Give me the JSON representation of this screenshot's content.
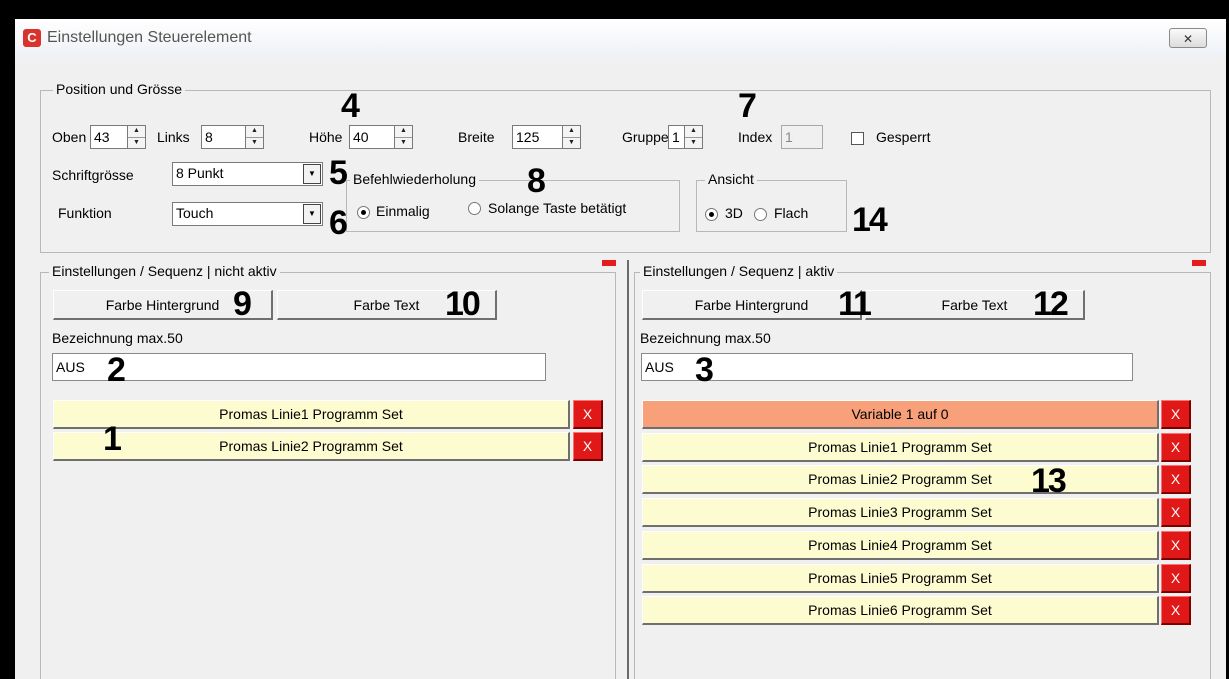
{
  "window": {
    "title": "Einstellungen Steuerelement",
    "close_label": "✕"
  },
  "position": {
    "legend": "Position und Grösse",
    "oben_label": "Oben",
    "oben_value": "43",
    "links_label": "Links",
    "links_value": "8",
    "hoehe_label": "Höhe",
    "hoehe_value": "40",
    "breite_label": "Breite",
    "breite_value": "125",
    "gruppe_label": "Gruppe",
    "gruppe_value": "1",
    "index_label": "Index",
    "index_value": "1",
    "gesperrt_label": "Gesperrt",
    "schriftgroesse_label": "Schriftgrösse",
    "schriftgroesse_value": "8 Punkt",
    "funktion_label": "Funktion",
    "funktion_value": "Touch"
  },
  "befehl": {
    "legend": "Befehlwiederholung",
    "option1": "Einmalig",
    "option2": "Solange Taste betätigt"
  },
  "ansicht": {
    "legend": "Ansicht",
    "option1": "3D",
    "option2": "Flach"
  },
  "left_panel": {
    "legend": "Einstellungen / Sequenz | nicht aktiv",
    "btn_bg": "Farbe Hintergrund",
    "btn_text": "Farbe Text",
    "bez_label": "Bezeichnung max.50",
    "bez_value": "AUS",
    "items": [
      "Promas Linie1 Programm Set",
      "Promas Linie2 Programm Set"
    ]
  },
  "right_panel": {
    "legend": "Einstellungen / Sequenz | aktiv",
    "btn_bg": "Farbe Hintergrund",
    "btn_text": "Farbe Text",
    "bez_label": "Bezeichnung max.50",
    "bez_value": "AUS",
    "items": [
      "Variable 1 auf 0",
      "Promas Linie1 Programm Set",
      "Promas Linie2 Programm Set",
      "Promas Linie3 Programm Set",
      "Promas Linie4 Programm Set",
      "Promas Linie5 Programm Set",
      "Promas Linie6 Programm Set"
    ]
  },
  "delete_label": "X",
  "annotations": [
    "1",
    "2",
    "3",
    "4",
    "5",
    "6",
    "7",
    "8",
    "9",
    "10",
    "11",
    "12",
    "13",
    "14"
  ],
  "colors": {
    "sequence_bg": "#fdfbd0",
    "sequence_highlight": "#f7a07a",
    "delete_red": "#e01818"
  }
}
